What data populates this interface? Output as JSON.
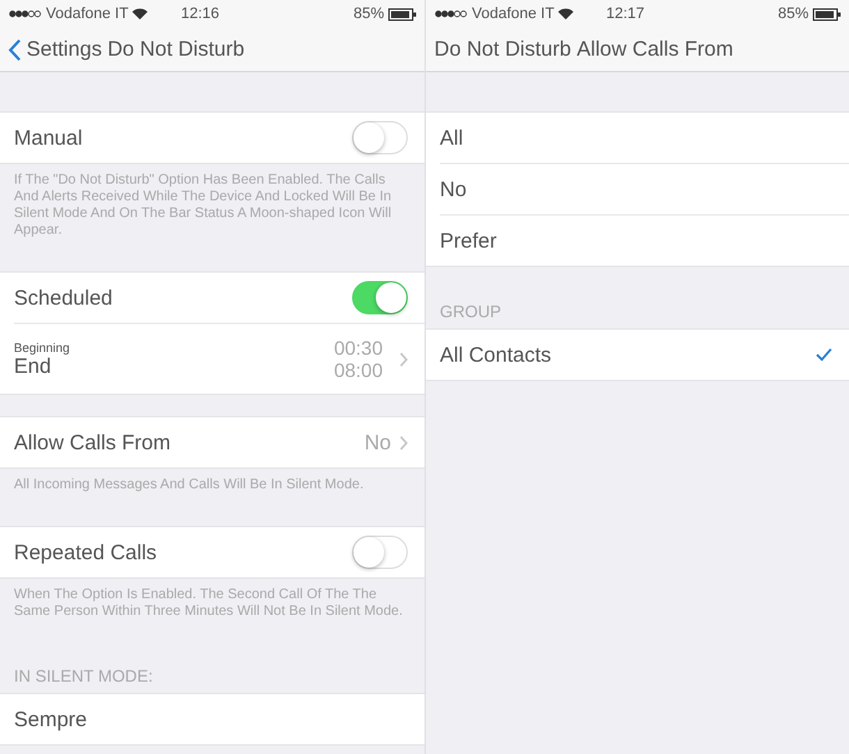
{
  "screens": [
    {
      "status_bar": {
        "carrier": "Vodafone IT",
        "time": "12:16",
        "battery": "85%"
      },
      "nav": {
        "chevron": true,
        "back": "Settings",
        "title": "Do Not Disturb"
      },
      "sections": [
        {
          "rows": [
            {
              "kind": "toggle",
              "label": "Manual",
              "on": false
            }
          ],
          "footer": "If The \"Do Not Disturb\" Option Has Been Enabled. The Calls And Alerts Received While The Device And Locked Will Be In Silent Mode And On The Bar Status A Moon-shaped Icon Will Appear."
        },
        {
          "rows": [
            {
              "kind": "toggle",
              "label": "Scheduled",
              "on": true
            },
            {
              "kind": "schedule",
              "start_label": "Beginning",
              "start_time": "00:30",
              "end_label": "End",
              "end_time": "08:00"
            }
          ]
        },
        {
          "rows": [
            {
              "kind": "disclosure",
              "label": "Allow Calls From",
              "value": "No"
            }
          ],
          "footer": "All Incoming Messages And Calls Will Be In Silent Mode."
        },
        {
          "rows": [
            {
              "kind": "toggle",
              "label": "Repeated Calls",
              "on": false
            }
          ],
          "footer": "When The Option Is Enabled. The Second Call Of The The Same Person Within Three Minutes Will Not Be In Silent Mode."
        },
        {
          "header": "IN SILENT MODE:",
          "rows": [
            {
              "kind": "plain",
              "label": "Sempre"
            }
          ]
        }
      ]
    },
    {
      "status_bar": {
        "carrier": "Vodafone IT",
        "time": "12:17",
        "battery": "85%"
      },
      "nav": {
        "chevron": false,
        "back": "Do Not Disturb",
        "title": "Allow Calls From"
      },
      "sections": [
        {
          "rows": [
            {
              "kind": "plain",
              "label": "All"
            },
            {
              "kind": "plain",
              "label": "No"
            },
            {
              "kind": "plain",
              "label": "Prefer"
            }
          ]
        },
        {
          "header": "GROUP",
          "rows": [
            {
              "kind": "check",
              "label": "All Contacts",
              "checked": true
            }
          ]
        }
      ]
    }
  ]
}
